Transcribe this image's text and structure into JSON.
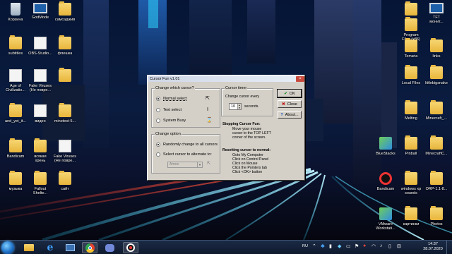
{
  "desktop": {
    "left_icons": [
      {
        "label": "Корзина",
        "type": "recycle"
      },
      {
        "label": "GodMode",
        "type": "monitor"
      },
      {
        "label": "самсаджив",
        "type": "folder"
      },
      {
        "label": "subtitles",
        "type": "folder"
      },
      {
        "label": "OBS-Studio...",
        "type": "doc"
      },
      {
        "label": "флешка",
        "type": "folder"
      },
      {
        "label": "Age of\nCivilizatio...",
        "type": "doc"
      },
      {
        "label": "Fake Viruses\n(Не поврe...",
        "type": "doc"
      },
      {
        "label": "",
        "type": "folder"
      },
      {
        "label": "and_yet_it...",
        "type": "folder"
      },
      {
        "label": "видео",
        "type": "doc"
      },
      {
        "label": "minetest-5...",
        "type": "folder"
      },
      {
        "label": "Bandicam",
        "type": "folder"
      },
      {
        "label": "всякая\nхрень",
        "type": "folder"
      },
      {
        "label": "Fake Viruses\n(Не поврe...",
        "type": "doc"
      },
      {
        "label": "музыка",
        "type": "folder"
      },
      {
        "label": "Fallout\nShelte...",
        "type": "folder"
      },
      {
        "label": "сайт",
        "type": "folder"
      }
    ],
    "right_icons": [
      {
        "label": "",
        "type": "folder"
      },
      {
        "label": "TFT\nмонит...",
        "type": "monitor"
      },
      {
        "label": "Program\nFiles (x86)",
        "type": "folder"
      },
      {
        "label": "Terraria",
        "type": "folder"
      },
      {
        "label": "links",
        "type": "folder"
      },
      {
        "label": "Local Files",
        "type": "folder"
      },
      {
        "label": "littlebigsnake",
        "type": "folder"
      },
      {
        "label": "Melting",
        "type": "folder"
      },
      {
        "label": "Minecraft_...",
        "type": "folder"
      },
      {
        "label": "BlueStacks",
        "type": "app"
      },
      {
        "label": "Pinball",
        "type": "folder"
      },
      {
        "label": "MinecraftC...",
        "type": "folder"
      },
      {
        "label": "Bandicam",
        "type": "record"
      },
      {
        "label": "windows xp\nsounds",
        "type": "folder"
      },
      {
        "label": "ORP-1.1-8...",
        "type": "folder"
      },
      {
        "label": "VMware\nWorkstati...",
        "type": "app"
      },
      {
        "label": "картинки",
        "type": "folder"
      },
      {
        "label": "Photos",
        "type": "folder"
      }
    ]
  },
  "dialog": {
    "title": "Cursor Fun v1.01",
    "close_glyph": "×",
    "which_cursor": {
      "group_title": "Change which cursor?",
      "options": [
        "Normal select",
        "Text select",
        "System Busy"
      ],
      "selected": 0
    },
    "change_option": {
      "group_title": "Change option",
      "randomly_label": "Randomly change to all cursors",
      "select_label": "Select cursor to alternate to:",
      "selected": 0,
      "combo_value": "Arrow"
    },
    "timer": {
      "group_title": "Cursor timer",
      "label": "Change cursor every",
      "value": "10",
      "unit": "seconds."
    },
    "buttons": {
      "ok": "OK",
      "close": "Close",
      "about": "About..."
    },
    "stopping": {
      "heading": "Stopping Cursor Fun:",
      "lines": [
        "Move your mouse",
        "cursor to the TOP LEFT",
        "corner of the screen."
      ]
    },
    "resetting": {
      "heading": "Resetting cursor to normal:",
      "lines": [
        "Goto My Computer",
        "Click on Control Panel",
        "Click on Mouse",
        "Click the Pointers tab",
        "Click <OK> button"
      ]
    }
  },
  "taskbar": {
    "apps": [
      "folder-app",
      "ie-app",
      "chrome-app",
      "discord-app",
      "obs-app"
    ],
    "language": "RU",
    "time": "14:37",
    "date": "28.07.2020"
  }
}
